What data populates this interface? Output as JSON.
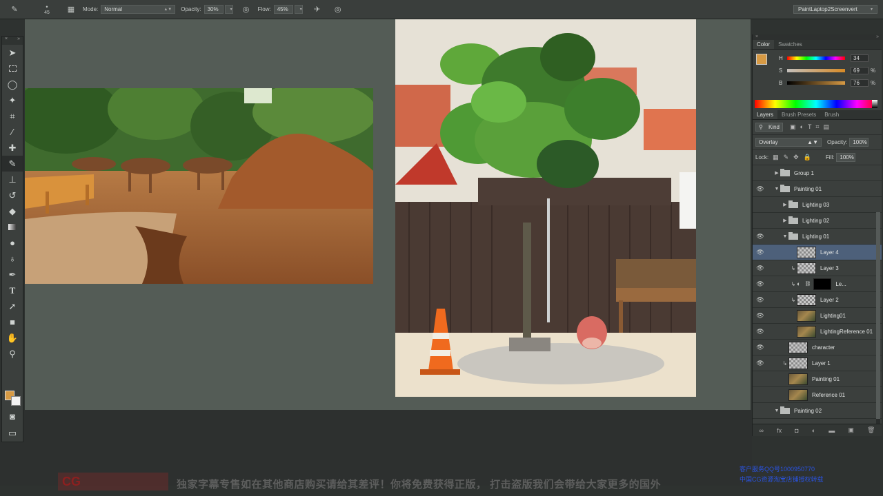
{
  "options_bar": {
    "brush_size": "45",
    "mode_label": "Mode:",
    "mode_value": "Normal",
    "opacity_label": "Opacity:",
    "opacity_value": "30%",
    "flow_label": "Flow:",
    "flow_value": "45%",
    "workspace": "PaintLaptop2Screenvert"
  },
  "toolbox": {
    "tools": [
      "move-tool",
      "marquee-tool",
      "lasso-tool",
      "quick-select-tool",
      "crop-tool",
      "eyedropper-tool",
      "spot-heal-tool",
      "brush-tool",
      "stamp-tool",
      "history-brush-tool",
      "eraser-tool",
      "gradient-tool",
      "blur-tool",
      "dodge-tool",
      "pen-tool",
      "type-tool",
      "path-select-tool",
      "shape-tool",
      "hand-tool",
      "zoom-tool"
    ],
    "active_tool": "brush-tool",
    "foreground_color": "#d79a44",
    "background_color": "#f2f2f2"
  },
  "color_panel": {
    "tabs": [
      "Color",
      "Swatches"
    ],
    "active_tab": "Color",
    "h_label": "H",
    "h_value": "34",
    "s_label": "S",
    "s_value": "69",
    "b_label": "B",
    "b_value": "76",
    "percent": "%"
  },
  "layers_panel": {
    "tabs": [
      "Layers",
      "Brush Presets",
      "Brush"
    ],
    "active_tab": "Layers",
    "filter_kind": "Kind",
    "blend_mode": "Overlay",
    "opacity_label": "Opacity:",
    "opacity_value": "100%",
    "lock_label": "Lock:",
    "fill_label": "Fill:",
    "fill_value": "100%",
    "layers": [
      {
        "name": "Group 1",
        "type": "group",
        "visible": false,
        "indent": 0,
        "expanded": false
      },
      {
        "name": "Painting 01",
        "type": "group",
        "visible": true,
        "indent": 0,
        "expanded": true
      },
      {
        "name": "Lighting 03",
        "type": "group",
        "visible": false,
        "indent": 1,
        "expanded": false
      },
      {
        "name": "Lighting 02",
        "type": "group",
        "visible": false,
        "indent": 1,
        "expanded": false
      },
      {
        "name": "Lighting 01",
        "type": "group",
        "visible": true,
        "indent": 1,
        "expanded": true
      },
      {
        "name": "Layer 4",
        "type": "layer",
        "visible": true,
        "indent": 2,
        "selected": true
      },
      {
        "name": "Layer 3",
        "type": "layer",
        "visible": true,
        "indent": 2,
        "clipped": true
      },
      {
        "name": "Le...",
        "type": "adjust",
        "visible": true,
        "indent": 2,
        "clipped": true
      },
      {
        "name": "Layer 2",
        "type": "layer",
        "visible": true,
        "indent": 2,
        "clipped": true
      },
      {
        "name": "Lighting01",
        "type": "image",
        "visible": true,
        "indent": 2
      },
      {
        "name": "LightingReference 01",
        "type": "image",
        "visible": true,
        "indent": 2
      },
      {
        "name": "character",
        "type": "layer",
        "visible": true,
        "indent": 1
      },
      {
        "name": "Layer 1",
        "type": "layer",
        "visible": true,
        "indent": 1,
        "clipped": true
      },
      {
        "name": "Painting 01",
        "type": "image",
        "visible": false,
        "indent": 1
      },
      {
        "name": "Reference 01",
        "type": "image",
        "visible": false,
        "indent": 1
      },
      {
        "name": "Painting 02",
        "type": "group",
        "visible": false,
        "indent": 0,
        "expanded": true
      }
    ]
  },
  "overlay": {
    "watermark": "CG",
    "subtitle": "独家字幕专售如在其他商店购买请给其差评！你将免费获得正版， 打击盗版我们会带给大家更多的国外",
    "corner_line1": "客户服务QQ号1000950770",
    "corner_line2": "中国CG资源淘宝店铺授权转载"
  },
  "colors": {
    "accent_selection": "#4d607a",
    "canvas_bg": "#545c56"
  }
}
